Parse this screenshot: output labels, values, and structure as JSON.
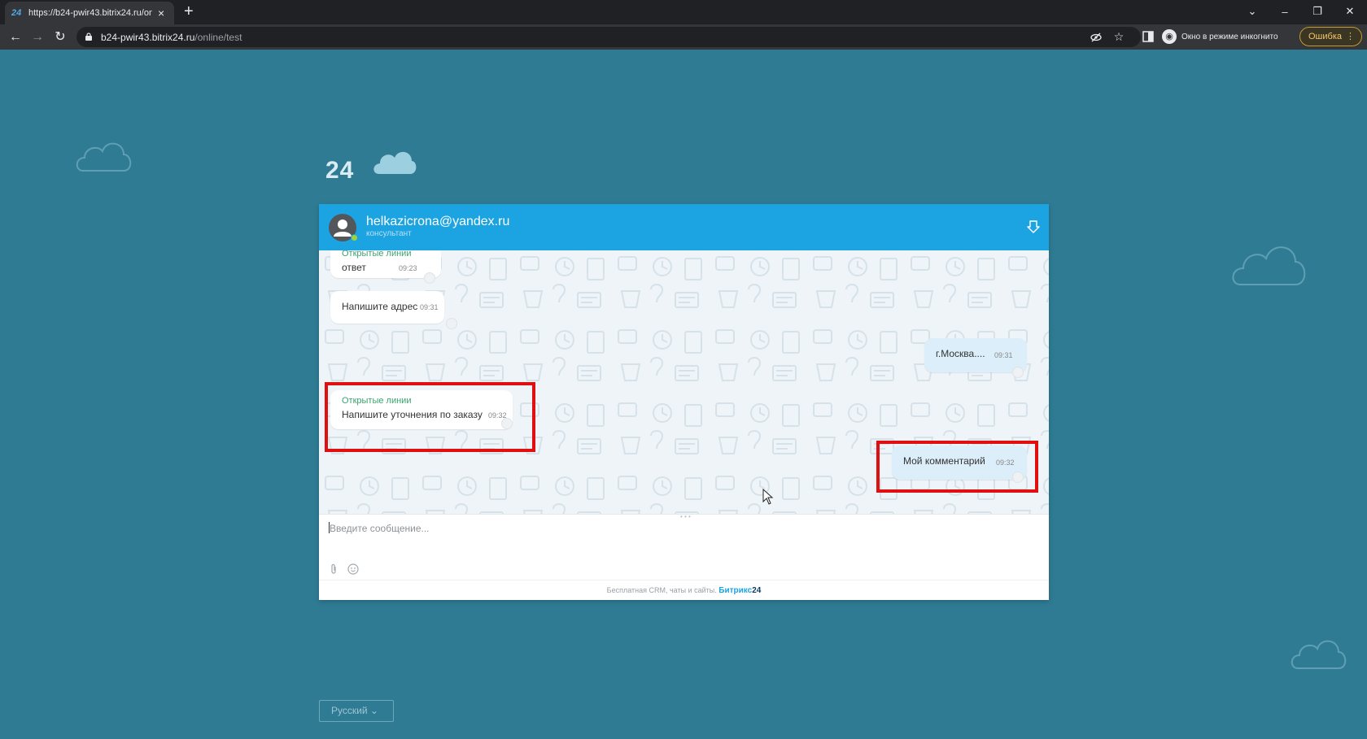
{
  "browser": {
    "tab_title": "https://b24-pwir43.bitrix24.ru/on",
    "tab_favicon": "24",
    "new_tab_label": "+",
    "url_host": "b24-pwir43.bitrix24.ru",
    "url_path": "/online/test",
    "incognito_label": "Окно в режиме инкогнито",
    "error_label": "Ошибка",
    "error_menu": "⋮"
  },
  "page": {
    "logo_text": "24",
    "language_label": "Русский"
  },
  "widget": {
    "operator_name": "helkazicrona@yandex.ru",
    "operator_role": "консультант",
    "messages": [
      {
        "direction": "in",
        "author": "Открытые линии",
        "text": "ответ",
        "time": "09:23"
      },
      {
        "direction": "in",
        "author": "",
        "text": "Напишите адрес",
        "time": "09:31"
      },
      {
        "direction": "out",
        "author": "",
        "text": "г.Москва....",
        "time": "09:31"
      },
      {
        "direction": "in",
        "author": "Открытые линии",
        "text": "Напишите уточнения по заказу",
        "time": "09:32",
        "highlighted": true
      },
      {
        "direction": "out",
        "author": "",
        "text": "Мой комментарий",
        "time": "09:32",
        "highlighted": true
      }
    ],
    "input_placeholder": "Введите сообщение...",
    "footer_text": "Бесплатная CRM, чаты и сайты.",
    "footer_brand": "Битрикс",
    "footer_brand_num": "24"
  },
  "colors": {
    "page_bg": "#2f7b94",
    "header_bg": "#1ca3e2",
    "highlight": "#e01010",
    "author_color": "#3aa36f"
  }
}
